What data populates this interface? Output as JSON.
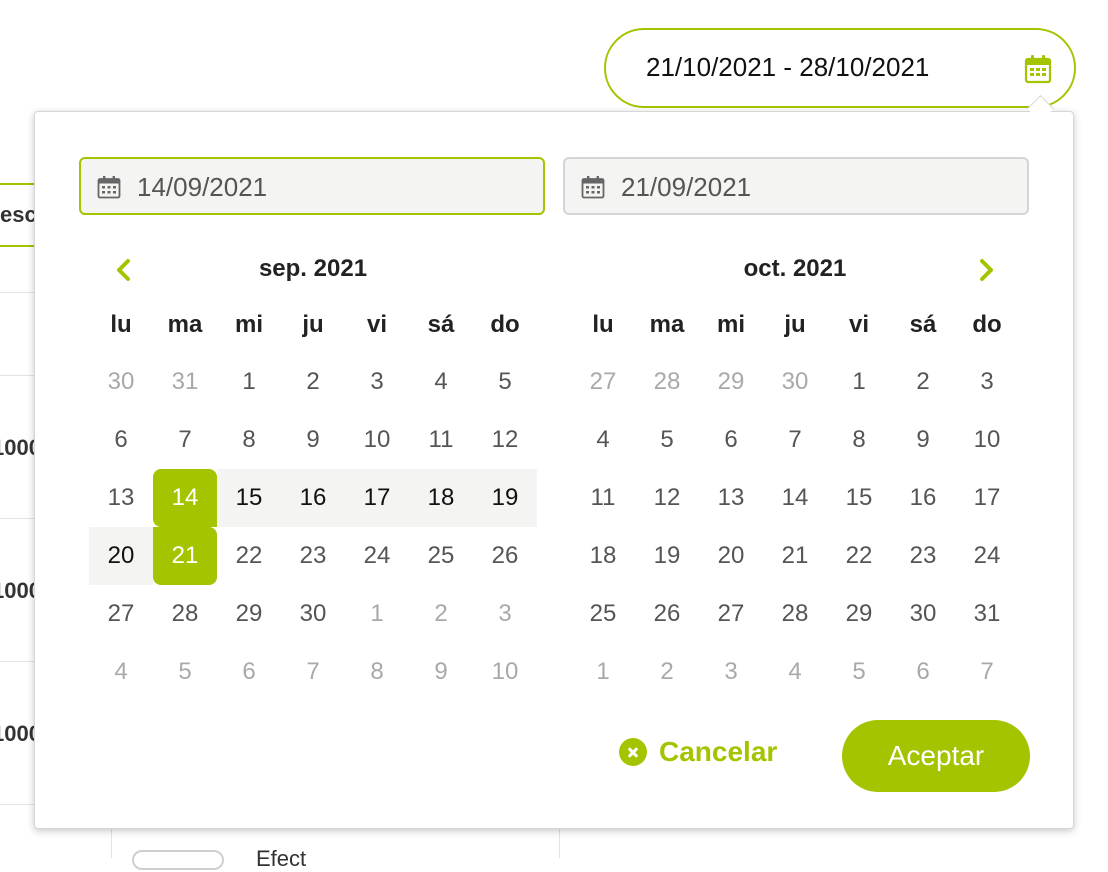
{
  "background": {
    "tab_label": "esc",
    "row_values": [
      "1000",
      "1000",
      "1000"
    ],
    "footer_text": "Efect"
  },
  "range_field": {
    "value": "21/10/2021 - 28/10/2021",
    "icon": "calendar-icon"
  },
  "picker": {
    "start_input": {
      "value": "14/09/2021",
      "icon": "calendar-icon"
    },
    "end_input": {
      "value": "21/09/2021",
      "icon": "calendar-icon"
    },
    "prev_icon": "chevron-left-icon",
    "next_icon": "chevron-right-icon",
    "weekdays": [
      "lu",
      "ma",
      "mi",
      "ju",
      "vi",
      "sá",
      "do"
    ],
    "months": [
      {
        "title": "sep. 2021",
        "weeks": [
          [
            {
              "d": "30",
              "m": 1
            },
            {
              "d": "31",
              "m": 1
            },
            {
              "d": "1"
            },
            {
              "d": "2"
            },
            {
              "d": "3"
            },
            {
              "d": "4"
            },
            {
              "d": "5"
            }
          ],
          [
            {
              "d": "6"
            },
            {
              "d": "7"
            },
            {
              "d": "8"
            },
            {
              "d": "9"
            },
            {
              "d": "10"
            },
            {
              "d": "11"
            },
            {
              "d": "12"
            }
          ],
          [
            {
              "d": "13"
            },
            {
              "d": "14",
              "s": "start"
            },
            {
              "d": "15",
              "r": 1
            },
            {
              "d": "16",
              "r": 1
            },
            {
              "d": "17",
              "r": 1
            },
            {
              "d": "18",
              "r": 1
            },
            {
              "d": "19",
              "r": 1
            }
          ],
          [
            {
              "d": "20",
              "r": 1
            },
            {
              "d": "21",
              "s": "end"
            },
            {
              "d": "22"
            },
            {
              "d": "23"
            },
            {
              "d": "24"
            },
            {
              "d": "25"
            },
            {
              "d": "26"
            }
          ],
          [
            {
              "d": "27"
            },
            {
              "d": "28"
            },
            {
              "d": "29"
            },
            {
              "d": "30"
            },
            {
              "d": "1",
              "m": 1
            },
            {
              "d": "2",
              "m": 1
            },
            {
              "d": "3",
              "m": 1
            }
          ],
          [
            {
              "d": "4",
              "m": 1
            },
            {
              "d": "5",
              "m": 1
            },
            {
              "d": "6",
              "m": 1
            },
            {
              "d": "7",
              "m": 1
            },
            {
              "d": "8",
              "m": 1
            },
            {
              "d": "9",
              "m": 1
            },
            {
              "d": "10",
              "m": 1
            }
          ]
        ]
      },
      {
        "title": "oct. 2021",
        "weeks": [
          [
            {
              "d": "27",
              "m": 1
            },
            {
              "d": "28",
              "m": 1
            },
            {
              "d": "29",
              "m": 1
            },
            {
              "d": "30",
              "m": 1
            },
            {
              "d": "1"
            },
            {
              "d": "2"
            },
            {
              "d": "3"
            }
          ],
          [
            {
              "d": "4"
            },
            {
              "d": "5"
            },
            {
              "d": "6"
            },
            {
              "d": "7"
            },
            {
              "d": "8"
            },
            {
              "d": "9"
            },
            {
              "d": "10"
            }
          ],
          [
            {
              "d": "11"
            },
            {
              "d": "12"
            },
            {
              "d": "13"
            },
            {
              "d": "14"
            },
            {
              "d": "15"
            },
            {
              "d": "16"
            },
            {
              "d": "17"
            }
          ],
          [
            {
              "d": "18"
            },
            {
              "d": "19"
            },
            {
              "d": "20"
            },
            {
              "d": "21"
            },
            {
              "d": "22"
            },
            {
              "d": "23"
            },
            {
              "d": "24"
            }
          ],
          [
            {
              "d": "25"
            },
            {
              "d": "26"
            },
            {
              "d": "27"
            },
            {
              "d": "28"
            },
            {
              "d": "29"
            },
            {
              "d": "30"
            },
            {
              "d": "31"
            }
          ],
          [
            {
              "d": "1",
              "m": 1
            },
            {
              "d": "2",
              "m": 1
            },
            {
              "d": "3",
              "m": 1
            },
            {
              "d": "4",
              "m": 1
            },
            {
              "d": "5",
              "m": 1
            },
            {
              "d": "6",
              "m": 1
            },
            {
              "d": "7",
              "m": 1
            }
          ]
        ]
      }
    ],
    "cancel_label": "Cancelar",
    "cancel_icon": "close-circle-icon",
    "accept_label": "Aceptar"
  },
  "colors": {
    "accent": "#a4c400",
    "range_bg": "#f4f4f2",
    "muted_text": "#a9a9a9"
  }
}
